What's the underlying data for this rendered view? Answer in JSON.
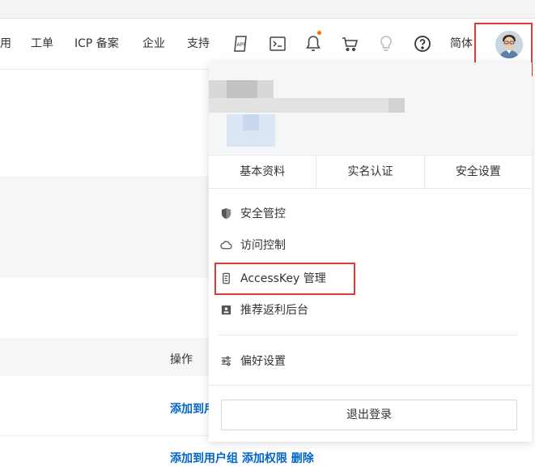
{
  "nav": {
    "partial_item": "用",
    "ticket": "工单",
    "icp": "ICP 备案",
    "enterprise": "企业",
    "support": "支持",
    "language": "简体"
  },
  "table": {
    "column_header": "操作",
    "row1_links": "添加到用",
    "row2_links": "添加到用户组  添加权限  删除"
  },
  "user_menu": {
    "tabs": [
      "基本资料",
      "实名认证",
      "安全设置"
    ],
    "items": [
      "安全管控",
      "访问控制",
      "AccessKey 管理",
      "推荐返利后台",
      "偏好设置"
    ],
    "logout": "退出登录"
  },
  "colors": {
    "highlight": "#e03a3a",
    "link": "#0064c8",
    "notification_dot": "#ff6a00"
  }
}
